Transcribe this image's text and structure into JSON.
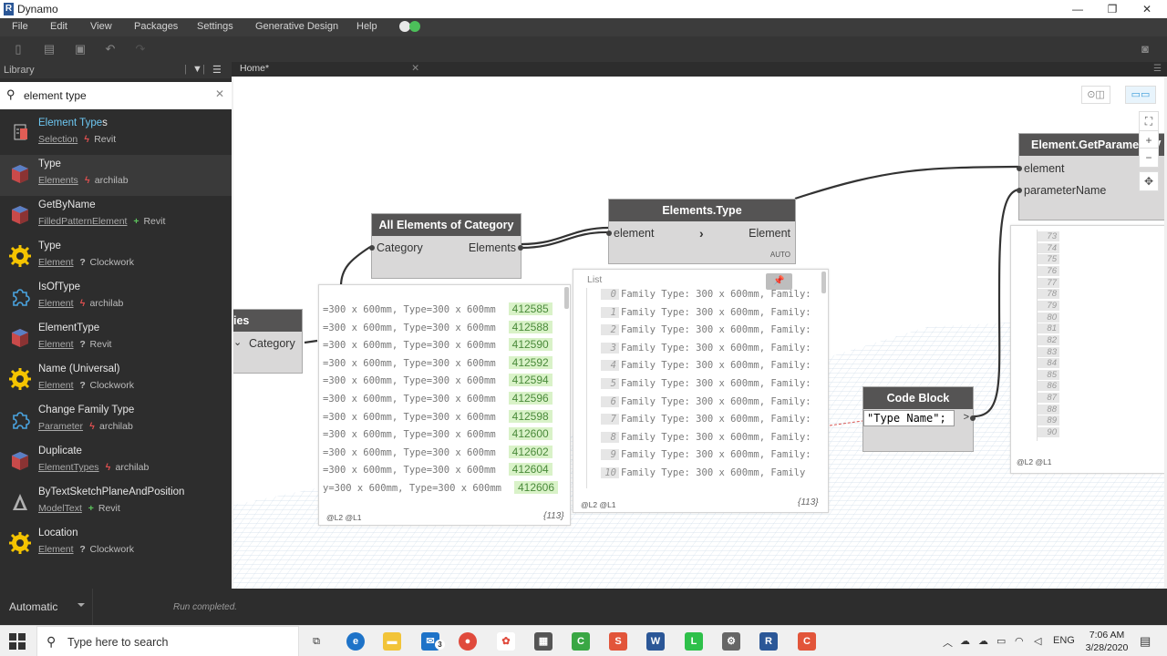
{
  "window": {
    "title": "Dynamo",
    "logo_letter": "R",
    "minimize": "—",
    "maximize": "❐",
    "close": "✕"
  },
  "menu": [
    "File",
    "Edit",
    "View",
    "Packages",
    "Settings",
    "Generative Design",
    "Help"
  ],
  "library": {
    "header": "Library",
    "search": {
      "value": "element type",
      "placeholder": ""
    },
    "items": [
      {
        "name_hl": "Element Type",
        "name_rest": "s",
        "category": "Selection",
        "mark": "ϟ",
        "source": "Revit",
        "icon": "selection-icon"
      },
      {
        "name_hl": "",
        "name_rest": "Type",
        "category": "Elements",
        "mark": "ϟ",
        "source": "archilab",
        "icon": "package-icon"
      },
      {
        "name_hl": "",
        "name_rest": "GetByName",
        "category": "FilledPatternElement",
        "mark": "+",
        "source": "Revit",
        "icon": "package-icon"
      },
      {
        "name_hl": "",
        "name_rest": "Type",
        "category": "Element",
        "mark": "?",
        "source": "Clockwork",
        "icon": "clockwork-icon"
      },
      {
        "name_hl": "",
        "name_rest": "IsOfType",
        "category": "Element",
        "mark": "ϟ",
        "source": "archilab",
        "icon": "puzzle-icon"
      },
      {
        "name_hl": "",
        "name_rest": "ElementType",
        "category": "Element",
        "mark": "?",
        "source": "Revit",
        "icon": "package-icon"
      },
      {
        "name_hl": "",
        "name_rest": "Name (Universal)",
        "category": "Element",
        "mark": "?",
        "source": "Clockwork",
        "icon": "clockwork-icon"
      },
      {
        "name_hl": "",
        "name_rest": "Change Family Type",
        "category": "Parameter",
        "mark": "ϟ",
        "source": "archilab",
        "icon": "puzzle-icon"
      },
      {
        "name_hl": "",
        "name_rest": "Duplicate",
        "category": "ElementTypes",
        "mark": "ϟ",
        "source": "archilab",
        "icon": "package-icon"
      },
      {
        "name_hl": "",
        "name_rest": "ByTextSketchPlaneAndPosition",
        "category": "ModelText",
        "mark": "+",
        "source": "Revit",
        "icon": "text-icon"
      },
      {
        "name_hl": "",
        "name_rest": "Location",
        "category": "Element",
        "mark": "?",
        "source": "Clockwork",
        "icon": "clockwork-icon"
      }
    ]
  },
  "tabs": [
    {
      "label": "Home*"
    }
  ],
  "canvas": {
    "nodes": {
      "categories": {
        "title": "ies",
        "output": "Category",
        "chevron": "⌄"
      },
      "all_elements": {
        "title": "All Elements of Category",
        "input": "Category",
        "output": "Elements"
      },
      "elements_type": {
        "title": "Elements.Type",
        "input": "element",
        "output": "Element",
        "chevron": "›",
        "lacing": "AUTO"
      },
      "get_parameter": {
        "title": "Element.GetParameterV",
        "input1": "element",
        "input2": "parameterName"
      },
      "code_block": {
        "title": "Code Block",
        "code": "\"Type Name\";",
        "output": ">"
      }
    },
    "preview_all": {
      "rows": [
        {
          "text": "=300 x 600mm, Type=300 x 600mm",
          "id": "412585"
        },
        {
          "text": "=300 x 600mm, Type=300 x 600mm",
          "id": "412588"
        },
        {
          "text": "=300 x 600mm, Type=300 x 600mm",
          "id": "412590"
        },
        {
          "text": "=300 x 600mm, Type=300 x 600mm",
          "id": "412592"
        },
        {
          "text": "=300 x 600mm, Type=300 x 600mm",
          "id": "412594"
        },
        {
          "text": "=300 x 600mm, Type=300 x 600mm",
          "id": "412596"
        },
        {
          "text": "=300 x 600mm, Type=300 x 600mm",
          "id": "412598"
        },
        {
          "text": "=300 x 600mm, Type=300 x 600mm",
          "id": "412600"
        },
        {
          "text": "=300 x 600mm, Type=300 x 600mm",
          "id": "412602"
        },
        {
          "text": "=300 x 600mm, Type=300 x 600mm",
          "id": "412604"
        },
        {
          "text": "y=300 x 600mm, Type=300 x 600mm",
          "id": "412606"
        }
      ],
      "levels": "@L2 @L1",
      "count": "{113}"
    },
    "preview_type": {
      "label": "List",
      "rows": [
        {
          "i": "0",
          "text": "Family Type: 300 x 600mm, Family:"
        },
        {
          "i": "1",
          "text": "Family Type: 300 x 600mm, Family:"
        },
        {
          "i": "2",
          "text": "Family Type: 300 x 600mm, Family:"
        },
        {
          "i": "3",
          "text": "Family Type: 300 x 600mm, Family:"
        },
        {
          "i": "4",
          "text": "Family Type: 300 x 600mm, Family:"
        },
        {
          "i": "5",
          "text": "Family Type: 300 x 600mm, Family:"
        },
        {
          "i": "6",
          "text": "Family Type: 300 x 600mm, Family:"
        },
        {
          "i": "7",
          "text": "Family Type: 300 x 600mm, Family:"
        },
        {
          "i": "8",
          "text": "Family Type: 300 x 600mm, Family:"
        },
        {
          "i": "9",
          "text": "Family Type: 300 x 600mm, Family:"
        },
        {
          "i": "10",
          "text": "Family Type: 300 x 600mm, Family"
        }
      ],
      "levels": "@L2 @L1",
      "count": "{113}"
    },
    "preview_param": {
      "indices": [
        "73",
        "74",
        "75",
        "76",
        "77",
        "78",
        "79",
        "80",
        "81",
        "82",
        "83",
        "84",
        "85",
        "86",
        "87",
        "88",
        "89",
        "90"
      ],
      "levels": "@L2 @L1"
    }
  },
  "status": {
    "run_mode": "Automatic",
    "message": "Run completed."
  },
  "taskbar": {
    "search_placeholder": "Type here to search",
    "lang": "ENG",
    "time": "7:06 AM",
    "date": "3/28/2020",
    "mail_badge": "3"
  },
  "colors": {
    "accent": "#6dc7f2",
    "node_header": "#555454",
    "node_body": "#d9d8d8",
    "green_chip": "#d9f2c8"
  }
}
